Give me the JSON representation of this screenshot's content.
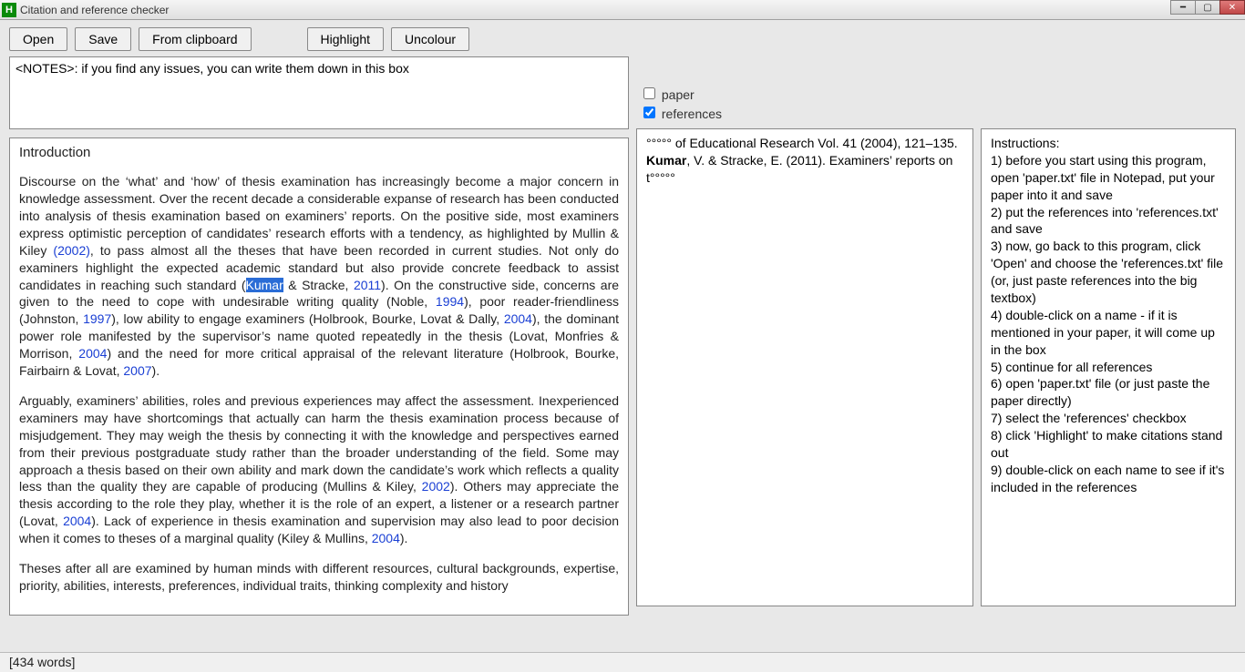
{
  "window": {
    "appicon_letter": "H",
    "title": "Citation and reference checker"
  },
  "toolbar": {
    "open": "Open",
    "save": "Save",
    "from_clipboard": "From clipboard",
    "highlight": "Highlight",
    "uncolour": "Uncolour"
  },
  "notes": {
    "value": "<NOTES>: if you find any issues, you can write them down in this box"
  },
  "checkboxes": {
    "paper": {
      "label": "paper",
      "checked": false
    },
    "references": {
      "label": "references",
      "checked": true
    }
  },
  "paper": {
    "heading": "Introduction",
    "p1a": "Discourse on the ‘what’ and ‘how’ of thesis examination has increasingly become a major concern in knowledge assessment. Over the recent decade a considerable expanse of research has been conducted into analysis of thesis examination based on examiners’ reports. On the positive side, most examiners express optimistic perception of candidates’ research efforts with a tendency, as highlighted by Mullin & Kiley ",
    "c1": "(2002)",
    "p1b": ", to pass almost all the theses that have been recorded in current studies. Not only do examiners highlight the expected academic standard but also provide concrete feedback to assist candidates in reaching such standard (",
    "c2_hl": "Kumar",
    "p1c": " & Stracke, ",
    "c2b": "2011",
    "p1d": "). On the constructive side, concerns are given to the need to cope with undesirable writing quality (Noble, ",
    "c3": "1994",
    "p1e": "), poor reader-friendliness (Johnston, ",
    "c4": "1997",
    "p1f": "), low ability to engage examiners (Holbrook, Bourke, Lovat & Dally, ",
    "c5": "2004",
    "p1g": "), the dominant power role manifested by the supervisor’s name quoted repeatedly in the thesis (Lovat, Monfries & Morrison, ",
    "c6": "2004",
    "p1h": ") and the need for more critical appraisal of the relevant literature (Holbrook, Bourke, Fairbairn & Lovat, ",
    "c7": "2007",
    "p1i": ").",
    "p2a": "Arguably, examiners’ abilities, roles and previous experiences may affect the assessment. Inexperienced examiners may have shortcomings that actually can harm the thesis examination process because of misjudgement. They may weigh the thesis by connecting it with the knowledge and perspectives earned from their previous postgraduate study rather than the broader understanding of the field. Some may approach a thesis based on their own ability and mark down the candidate’s work which reflects a quality less than the quality they are capable of producing (Mullins & Kiley, ",
    "c8": "2002",
    "p2b": "). Others may appreciate the thesis according to the role they play, whether it is the role of an expert, a listener or a research partner (Lovat, ",
    "c9": "2004",
    "p2c": "). Lack of experience in thesis examination and supervision may also lead to poor decision when it comes to theses of a marginal quality (Kiley & Mullins, ",
    "c10": "2004",
    "p2d": ").",
    "p3": "Theses after all are examined by human minds with different resources, cultural backgrounds, expertise, priority, abilities, interests, preferences, individual traits, thinking complexity and history"
  },
  "references": {
    "line1_pre": "°°°°° of Educational Research Vol. 41 (2004), 121–135.",
    "line2_author": "Kumar",
    "line2_rest": ", V. & Stracke, E. (2011). Examiners’ reports on t°°°°°"
  },
  "instructions": {
    "title": "Instructions:",
    "i1": "1) before you start using this program, open 'paper.txt' file in Notepad, put your paper into it and save",
    "i2": "2) put the references into 'references.txt' and save",
    "i3": "3) now, go back to this program, click 'Open' and choose the 'references.txt' file (or, just paste references into the big textbox)",
    "i4": "4) double-click on a name - if it is mentioned in your paper, it will come up in the box",
    "i5": "5) continue for all references",
    "i6": "6) open 'paper.txt' file (or just paste the paper directly)",
    "i7": "7) select the 'references' checkbox",
    "i8": "8) click 'Highlight' to make citations stand out",
    "i9": "9) double-click on each name to see if it's included in the references"
  },
  "status": {
    "wordcount": "[434 words]"
  }
}
